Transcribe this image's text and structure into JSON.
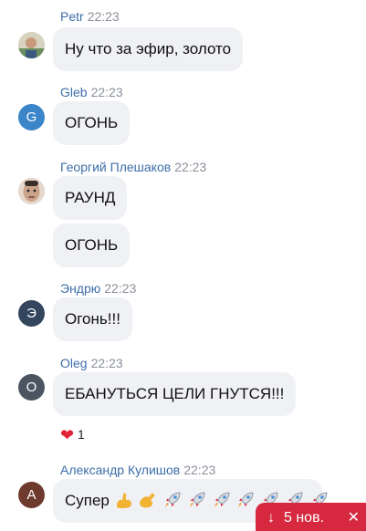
{
  "messages": [
    {
      "sender": "Petr",
      "time": "22:23",
      "avatar_letter": "",
      "avatar_color": "#c7b89a",
      "bubbles": [
        "Ну что за эфир, золото"
      ]
    },
    {
      "sender": "Gleb",
      "time": "22:23",
      "avatar_letter": "G",
      "avatar_color": "#3a86c8",
      "bubbles": [
        "ОГОНЬ"
      ]
    },
    {
      "sender": "Георгий Плешаков",
      "time": "22:23",
      "avatar_letter": "",
      "avatar_color": "#d9c2b2",
      "bubbles": [
        "РАУНД",
        "ОГОНЬ"
      ]
    },
    {
      "sender": "Эндрю",
      "time": "22:23",
      "avatar_letter": "Э",
      "avatar_color": "#33465e",
      "bubbles": [
        "Огонь!!!"
      ]
    },
    {
      "sender": "Oleg",
      "time": "22:23",
      "avatar_letter": "O",
      "avatar_color": "#4a5561",
      "bubbles": [
        "ЕБАНУТЬСЯ ЦЕЛИ ГНУТСЯ!!!"
      ]
    },
    {
      "sender": "Александр Кулишов",
      "time": "22:23",
      "avatar_letter": "A",
      "avatar_color": "#6e3a2e",
      "bubbles": [
        "Супер"
      ]
    }
  ],
  "reaction": {
    "icon": "heart-icon",
    "count": "1"
  },
  "last_message_emojis": [
    "flexed-biceps-icon",
    "flexed-biceps-icon",
    "rocket-icon",
    "rocket-icon",
    "rocket-icon",
    "rocket-icon",
    "rocket-icon",
    "rocket-icon",
    "rocket-icon"
  ],
  "new_messages": {
    "arrow": "↓",
    "label": "5 нов.",
    "close": "✕",
    "color": "#d6293f"
  }
}
